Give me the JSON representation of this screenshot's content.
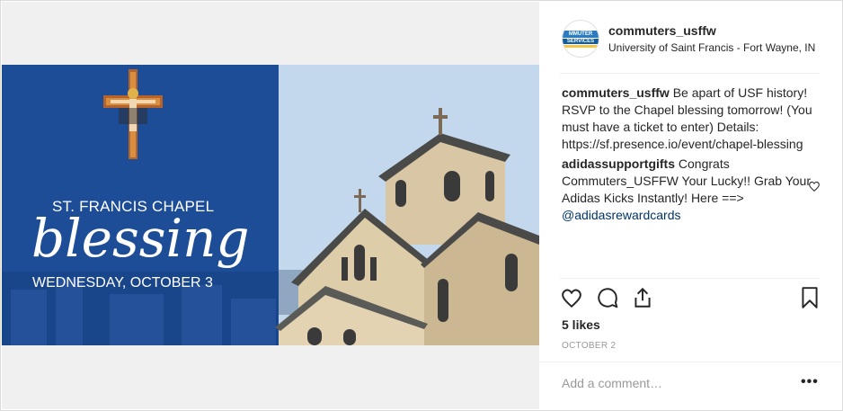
{
  "post": {
    "username": "commuters_usffw",
    "location": "University of Saint Francis - Fort Wayne, IN",
    "avatar_text_top": "MMUTER",
    "avatar_text_bottom": "SERVICES",
    "image": {
      "event_title_line1": "ST. FRANCIS CHAPEL",
      "event_title_script": "blessing",
      "event_date": "WEDNESDAY, OCTOBER 3",
      "colors": {
        "blue_panel": "#1d4d96",
        "sky": "#c9dcef",
        "stone": "#d8c6a4",
        "roof": "#4a4a48"
      }
    },
    "caption": {
      "author": "commuters_usffw",
      "text": "Be apart of USF history! RSVP to the Chapel blessing tomorrow! (You must have a ticket to enter) Details: https://sf.presence.io/event/chapel-blessing"
    },
    "comments": [
      {
        "author": "adidassupportgifts",
        "text": "Congrats Commuters_USFFW Your Lucky!! Grab Your Adidas Kicks Instantly! Here ==> ",
        "mention": "@adidasrewardcards"
      }
    ],
    "icons": [
      "heart-icon",
      "comment-icon",
      "share-icon",
      "bookmark-icon",
      "more-icon"
    ],
    "likes": "5 likes",
    "date": "OCTOBER 2",
    "add_comment_placeholder": "Add a comment…",
    "more_label": "•••"
  }
}
